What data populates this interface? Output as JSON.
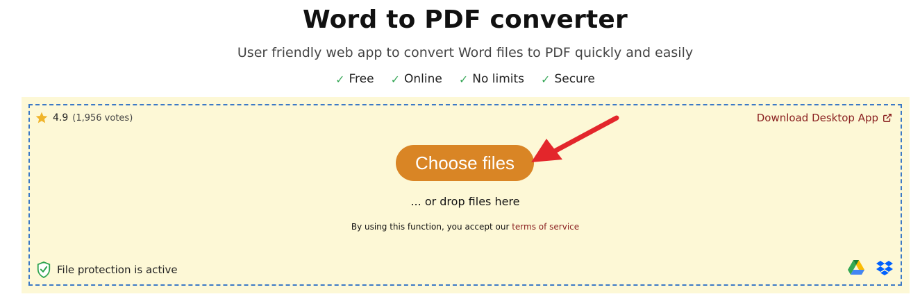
{
  "header": {
    "title": "Word to PDF converter",
    "subtitle": "User friendly web app to convert Word files to PDF quickly and easily",
    "features": [
      {
        "check": "✓",
        "label": "Free"
      },
      {
        "check": "✓",
        "label": "Online"
      },
      {
        "check": "✓",
        "label": "No limits"
      },
      {
        "check": "✓",
        "label": "Secure"
      }
    ]
  },
  "dropzone": {
    "rating": {
      "score": "4.9",
      "votes": "(1,956 votes)"
    },
    "desktop_link": "Download Desktop App",
    "choose_button": "Choose files",
    "drop_text": "... or drop files here",
    "tos_prefix": "By using this function, you accept our ",
    "tos_link": "terms of service",
    "protection": "File protection is active",
    "cloud_icons": [
      "google-drive-icon",
      "dropbox-icon"
    ]
  },
  "colors": {
    "accent": "#d98525",
    "link": "#8a2020",
    "dropzone_bg": "#fdf8d6",
    "dropzone_border": "#3b79c6",
    "check": "#3aa85a",
    "arrow": "#e3262b"
  }
}
